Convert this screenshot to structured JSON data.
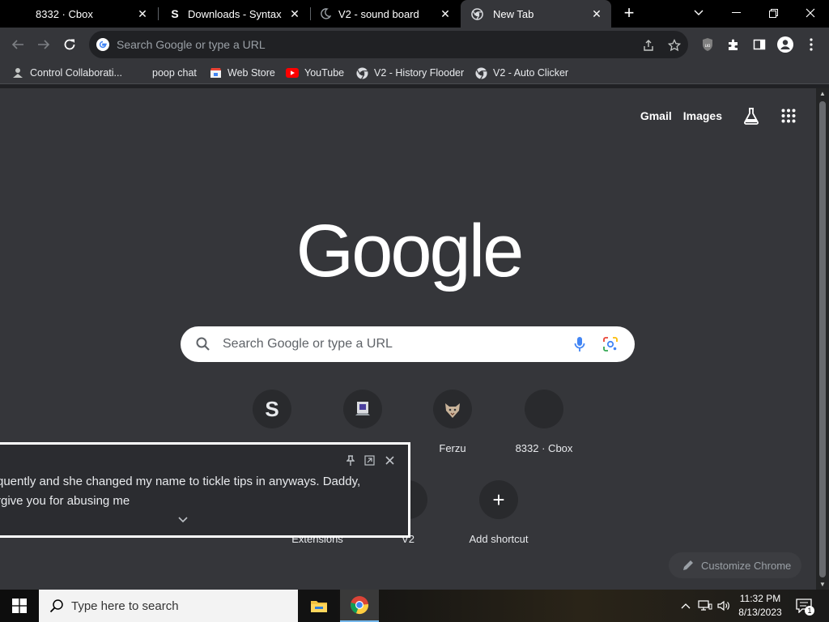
{
  "tabs": [
    {
      "title": "8332 · Cbox",
      "active": false
    },
    {
      "title": "Downloads - Syntax",
      "active": false,
      "favicon_letter": "S"
    },
    {
      "title": "V2 - sound board",
      "active": false
    },
    {
      "title": "New Tab",
      "active": true
    }
  ],
  "omnibox": {
    "placeholder": "Search Google or type a URL"
  },
  "bookmarks": [
    {
      "label": "Control Collaborati..."
    },
    {
      "label": "poop chat"
    },
    {
      "label": "Web Store"
    },
    {
      "label": "YouTube"
    },
    {
      "label": "V2 - History Flooder"
    },
    {
      "label": "V2 - Auto Clicker"
    }
  ],
  "ntp": {
    "links": {
      "gmail": "Gmail",
      "images": "Images"
    },
    "search_placeholder": "Search Google or type a URL",
    "shortcuts": [
      {
        "label": "",
        "letter": "S"
      },
      {
        "label": ""
      },
      {
        "label": "Ferzu"
      },
      {
        "label": "8332 · Cbox"
      },
      {
        "label": "Extensions"
      },
      {
        "label": "V2"
      },
      {
        "label": "Add shortcut",
        "letter": "+"
      }
    ],
    "customize_label": "Customize Chrome"
  },
  "popup": {
    "line1": "quently and she changed my name to tickle tips in anyways. Daddy,",
    "line2": "rgive you for abusing me"
  },
  "taskbar": {
    "search_placeholder": "Type here to search",
    "time": "11:32 PM",
    "date": "8/13/2023",
    "notification_count": "1"
  },
  "colors": {
    "accent": "#8ab4f8",
    "page_bg": "#35363a",
    "tab_strip": "#000000"
  }
}
